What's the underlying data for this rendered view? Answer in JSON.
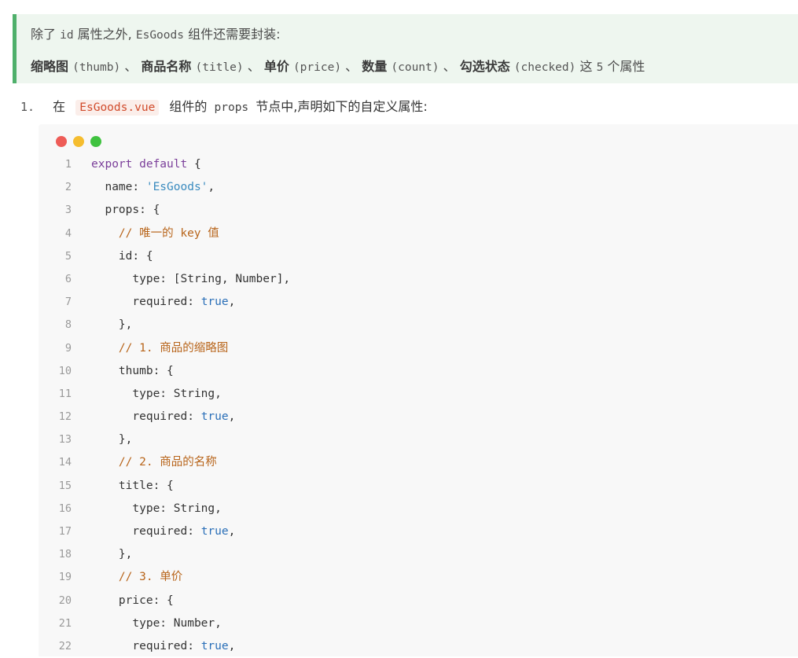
{
  "tip": {
    "line1": {
      "prefix": "除了",
      "code_id": "id",
      "middle": "属性之外,",
      "code_component": "EsGoods",
      "suffix": "组件还需要封装:"
    },
    "line2": {
      "thumb_label": "缩略图",
      "thumb_code": "(thumb)",
      "sep1": "、",
      "title_label": "商品名称",
      "title_code": "(title)",
      "sep2": "、",
      "price_label": "单价",
      "price_code": "(price)",
      "sep3": "、",
      "count_label": "数量",
      "count_code": "(count)",
      "sep4": "、",
      "checked_label": "勾选状态",
      "checked_code": "(checked)",
      "tail_a": "这",
      "tail_num": "5",
      "tail_b": "个属性"
    }
  },
  "step": {
    "number": "1.",
    "text_a": "在",
    "file": "EsGoods.vue",
    "text_b": "组件的",
    "props_code": "props",
    "text_c": "节点中,声明如下的自定义属性:"
  },
  "window_dots": {
    "red": "#ee5c57",
    "yellow": "#f5bd2f",
    "green": "#3fc23f"
  },
  "code_lines": [
    {
      "n": "1",
      "parts": [
        [
          "kw",
          "export default"
        ],
        [
          "p",
          " {"
        ]
      ]
    },
    {
      "n": "2",
      "parts": [
        [
          "p",
          "  name: "
        ],
        [
          "str",
          "'EsGoods'"
        ],
        [
          "p",
          ","
        ]
      ]
    },
    {
      "n": "3",
      "parts": [
        [
          "p",
          "  props: {"
        ]
      ]
    },
    {
      "n": "4",
      "parts": [
        [
          "cm",
          "    // 唯一的 key 值"
        ]
      ]
    },
    {
      "n": "5",
      "parts": [
        [
          "p",
          "    id: {"
        ]
      ]
    },
    {
      "n": "6",
      "parts": [
        [
          "p",
          "      type: [String, Number],"
        ]
      ]
    },
    {
      "n": "7",
      "parts": [
        [
          "p",
          "      required: "
        ],
        [
          "bool",
          "true"
        ],
        [
          "p",
          ","
        ]
      ]
    },
    {
      "n": "8",
      "parts": [
        [
          "p",
          "    },"
        ]
      ]
    },
    {
      "n": "9",
      "parts": [
        [
          "cm",
          "    // 1. 商品的缩略图"
        ]
      ]
    },
    {
      "n": "10",
      "parts": [
        [
          "p",
          "    thumb: {"
        ]
      ]
    },
    {
      "n": "11",
      "parts": [
        [
          "p",
          "      type: String,"
        ]
      ]
    },
    {
      "n": "12",
      "parts": [
        [
          "p",
          "      required: "
        ],
        [
          "bool",
          "true"
        ],
        [
          "p",
          ","
        ]
      ]
    },
    {
      "n": "13",
      "parts": [
        [
          "p",
          "    },"
        ]
      ]
    },
    {
      "n": "14",
      "parts": [
        [
          "cm",
          "    // 2. 商品的名称"
        ]
      ]
    },
    {
      "n": "15",
      "parts": [
        [
          "p",
          "    title: {"
        ]
      ]
    },
    {
      "n": "16",
      "parts": [
        [
          "p",
          "      type: String,"
        ]
      ]
    },
    {
      "n": "17",
      "parts": [
        [
          "p",
          "      required: "
        ],
        [
          "bool",
          "true"
        ],
        [
          "p",
          ","
        ]
      ]
    },
    {
      "n": "18",
      "parts": [
        [
          "p",
          "    },"
        ]
      ]
    },
    {
      "n": "19",
      "parts": [
        [
          "cm",
          "    // 3. 单价"
        ]
      ]
    },
    {
      "n": "20",
      "parts": [
        [
          "p",
          "    price: {"
        ]
      ]
    },
    {
      "n": "21",
      "parts": [
        [
          "p",
          "      type: Number,"
        ]
      ]
    },
    {
      "n": "22",
      "parts": [
        [
          "p",
          "      required: "
        ],
        [
          "bool",
          "true"
        ],
        [
          "p",
          ","
        ]
      ]
    }
  ]
}
